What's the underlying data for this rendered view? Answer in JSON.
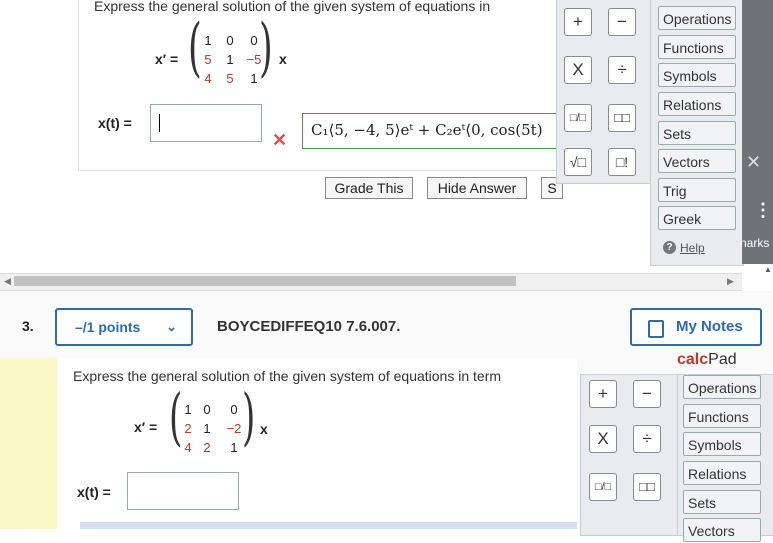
{
  "q1": {
    "prompt": "Express the general solution of the given system of equations in",
    "lhs": "x′ =",
    "matrix": [
      [
        "1",
        "0",
        "0"
      ],
      [
        "5",
        "1",
        "−5"
      ],
      [
        "4",
        "5",
        "1"
      ]
    ],
    "rhs": "x",
    "x_label": "x(t) =",
    "answer": "C₁⟨5, −4, 5⟩eᵗ + C₂eᵗ⟨0, cos(5t)",
    "grade_label": "Grade This",
    "hide_label": "Hide Answer",
    "cut_label": "S"
  },
  "pad1": {
    "keys": [
      "+",
      "−",
      "X",
      "÷",
      "□/□",
      "□□",
      "√□",
      "□!"
    ],
    "menu": [
      "Operations",
      "Functions",
      "Symbols",
      "Relations",
      "Sets",
      "Vectors",
      "Trig",
      "Greek"
    ],
    "help": "Help"
  },
  "side": {
    "marks_partial": "narks"
  },
  "q3": {
    "number": "3.",
    "points": "–/1 points",
    "code": "BOYCEDIFFEQ10 7.6.007.",
    "my_notes": "My Notes",
    "prompt": "Express the general solution of the given system of equations in term",
    "lhs": "x′ =",
    "matrix": [
      [
        "1",
        "0",
        "0"
      ],
      [
        "2",
        "1",
        "−2"
      ],
      [
        "4",
        "2",
        "1"
      ]
    ],
    "rhs": "x",
    "x_label": "x(t) ="
  },
  "pad2": {
    "title_calc": "calc",
    "title_pad": "Pad",
    "keys": [
      "+",
      "−",
      "X",
      "÷",
      "□/□",
      "□□"
    ],
    "menu": [
      "Operations",
      "Functions",
      "Symbols",
      "Relations",
      "Sets",
      "Vectors"
    ]
  }
}
